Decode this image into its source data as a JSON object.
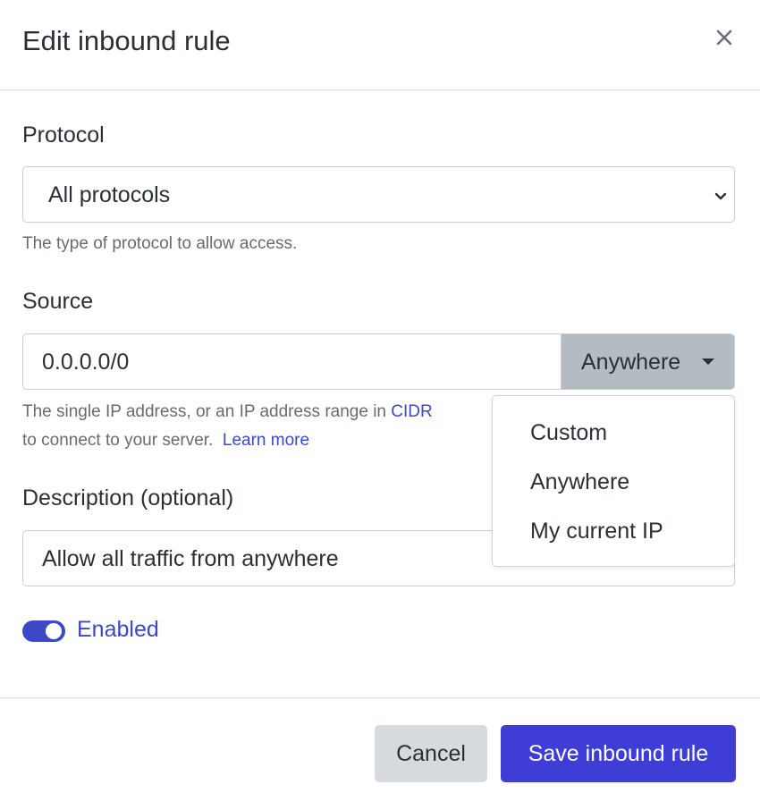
{
  "dialog": {
    "title": "Edit inbound rule",
    "close_icon": "close-icon"
  },
  "protocol": {
    "label": "Protocol",
    "selected": "All protocols",
    "help": "The type of protocol to allow access."
  },
  "source": {
    "label": "Source",
    "value": "0.0.0.0/0",
    "dropdown_selected": "Anywhere",
    "help_line1": "The single IP address, or an IP address range in",
    "help_link_cidr": "CIDR",
    "help_line2": "to connect to your server.",
    "help_link_learn": "Learn more",
    "menu_items": [
      "Custom",
      "Anywhere",
      "My current IP"
    ]
  },
  "description": {
    "label": "Description (optional)",
    "value": "Allow all traffic from anywhere"
  },
  "toggle": {
    "label": "Enabled",
    "on": true
  },
  "footer": {
    "cancel_label": "Cancel",
    "save_label": "Save inbound rule"
  },
  "colors": {
    "accent": "#3b48c8",
    "primary_button": "#3e3ed6",
    "secondary_button": "#d6dade",
    "dropdown_button": "#b4bbc3"
  }
}
